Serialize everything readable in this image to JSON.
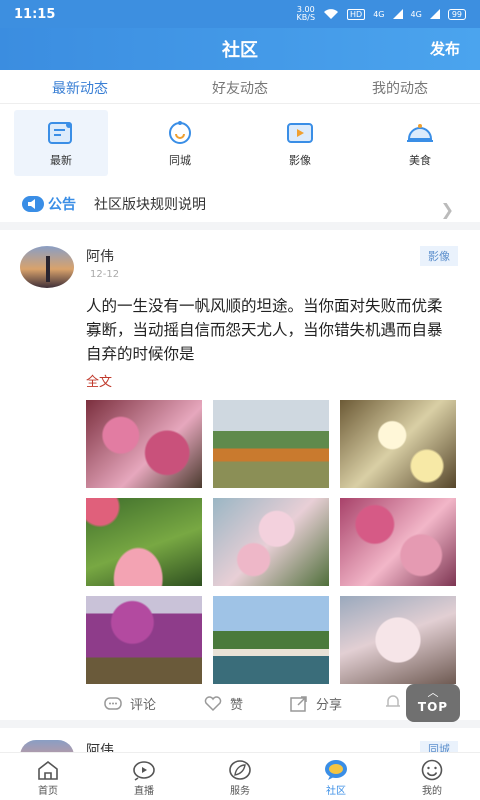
{
  "status": {
    "time": "11:15",
    "speed_value": "3.00",
    "speed_unit": "KB/S",
    "hd": "HD",
    "sig1": "4G",
    "sig2": "4G",
    "battery": "99"
  },
  "header": {
    "title": "社区",
    "publish_label": "发布"
  },
  "tabs": [
    {
      "label": "最新动态",
      "active": true
    },
    {
      "label": "好友动态",
      "active": false
    },
    {
      "label": "我的动态",
      "active": false
    }
  ],
  "categories": [
    {
      "label": "最新",
      "icon": "newest-icon",
      "active": true
    },
    {
      "label": "同城",
      "icon": "same-city-icon",
      "active": false
    },
    {
      "label": "影像",
      "icon": "video-icon",
      "active": false
    },
    {
      "label": "美食",
      "icon": "food-cloche-icon",
      "active": false
    }
  ],
  "notice": {
    "badge": "公告",
    "text": "社区版块规则说明"
  },
  "post": {
    "username": "阿伟",
    "date": "12-12",
    "tag": "影像",
    "text": "人的一生没有一帆风顺的坦途。当你面对失败而优柔寡断，当动摇自信而怨天尤人，当你错失机遇而自暴自弃的时候你是",
    "read_more": "全文",
    "actions": {
      "comment": "评论",
      "like": "赞",
      "share": "分享"
    }
  },
  "top_button": {
    "label": "TOP"
  },
  "post2": {
    "username": "阿伟",
    "tag": "同城"
  },
  "bottom_nav": [
    {
      "label": "首页",
      "icon": "home-icon",
      "active": false
    },
    {
      "label": "直播",
      "icon": "live-icon",
      "active": false
    },
    {
      "label": "服务",
      "icon": "service-leaf-icon",
      "active": false
    },
    {
      "label": "社区",
      "icon": "community-chat-icon",
      "active": true
    },
    {
      "label": "我的",
      "icon": "profile-smile-icon",
      "active": false
    }
  ],
  "colors": {
    "brand": "#3b8de0",
    "accent_link": "#c0392b",
    "tag_bg": "#eaf2fc"
  }
}
